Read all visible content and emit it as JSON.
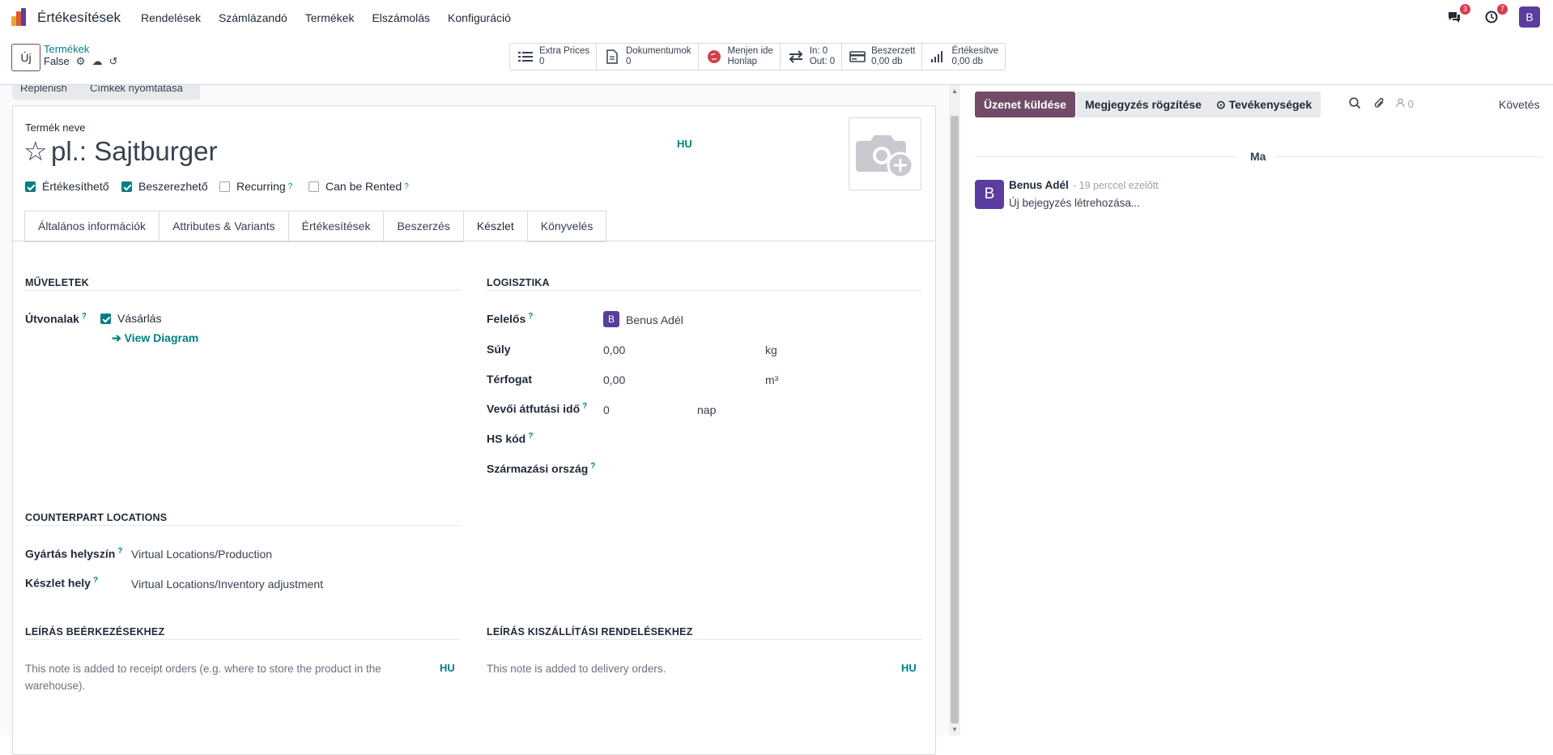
{
  "navbar": {
    "app_name": "Értékesítések",
    "menu": [
      "Rendelések",
      "Számlázandó",
      "Termékek",
      "Elszámolás",
      "Konfiguráció"
    ],
    "messages_badge": "3",
    "activities_badge": "7",
    "user_initial": "B"
  },
  "control": {
    "new_label": "Új",
    "breadcrumb_parent": "Termékek",
    "breadcrumb_current": "False",
    "stats": [
      {
        "icon": "list-icon",
        "line1": "Extra Prices",
        "line2": "0"
      },
      {
        "icon": "document-icon",
        "line1": "Dokumentumok",
        "line2": "0"
      },
      {
        "icon": "globe-icon",
        "line1": "Menjen ide",
        "line2": "Honlap"
      },
      {
        "icon": "transfer-icon",
        "line1": "In: 0",
        "line2": "Out: 0"
      },
      {
        "icon": "credit-card-icon",
        "line1": "Beszerzett",
        "line2": "0,00 db"
      },
      {
        "icon": "bar-chart-icon",
        "line1": "Értékesítve",
        "line2": "0,00 db"
      }
    ]
  },
  "status_buttons": [
    "Replenish",
    "Címkék nyomtatása"
  ],
  "form": {
    "name_label": "Termék neve",
    "name_placeholder": "pl.: Sajtburger",
    "lang": "HU",
    "checkboxes": [
      {
        "label": "Értékesíthető",
        "checked": true,
        "help": ""
      },
      {
        "label": "Beszerezhető",
        "checked": true,
        "help": ""
      },
      {
        "label": "Recurring",
        "checked": false,
        "help": "?"
      },
      {
        "label": "Can be Rented",
        "checked": false,
        "help": "?"
      }
    ],
    "tabs": [
      "Általános információk",
      "Attributes & Variants",
      "Értékesítések",
      "Beszerzés",
      "Készlet",
      "Könyvelés"
    ],
    "active_tab": "Készlet",
    "help": "?",
    "operations": {
      "title": "Műveletek",
      "routes_label": "Útvonalak",
      "route_value": "Vásárlás",
      "diagram_link": "View Diagram"
    },
    "logistics": {
      "title": "Logisztika",
      "responsible_label": "Felelős",
      "responsible_initial": "B",
      "responsible_value": "Benus Adél",
      "weight_label": "Súly",
      "weight_value": "0,00",
      "weight_unit": "kg",
      "volume_label": "Térfogat",
      "volume_value": "0,00",
      "volume_unit": "m³",
      "lead_label": "Vevői átfutási idő",
      "lead_value": "0",
      "lead_unit": "nap",
      "hs_label": "HS kód",
      "origin_label": "Származási ország"
    },
    "counterpart": {
      "title": "Counterpart Locations",
      "production_label": "Gyártás helyszín",
      "production_value": "Virtual Locations/Production",
      "inventory_label": "Készlet hely",
      "inventory_value": "Virtual Locations/Inventory adjustment"
    },
    "receipt": {
      "title": "Leírás beérkezésekhez",
      "placeholder": "This note is added to receipt orders (e.g. where to store the product in the warehouse)."
    },
    "delivery": {
      "title": "Leírás kiszállítási rendelésekhez",
      "placeholder": "This note is added to delivery orders."
    }
  },
  "chatter": {
    "send_label": "Üzenet küldése",
    "note_label": "Megjegyzés rögzítése",
    "activities_label": "Tevékenységek",
    "followers_count": "0",
    "follow_label": "Követés",
    "day": "Ma",
    "message": {
      "avatar_initial": "B",
      "author": "Benus Adél",
      "time": "- 19 perccel ezelőtt",
      "body": "Új bejegyzés létrehozása..."
    }
  }
}
